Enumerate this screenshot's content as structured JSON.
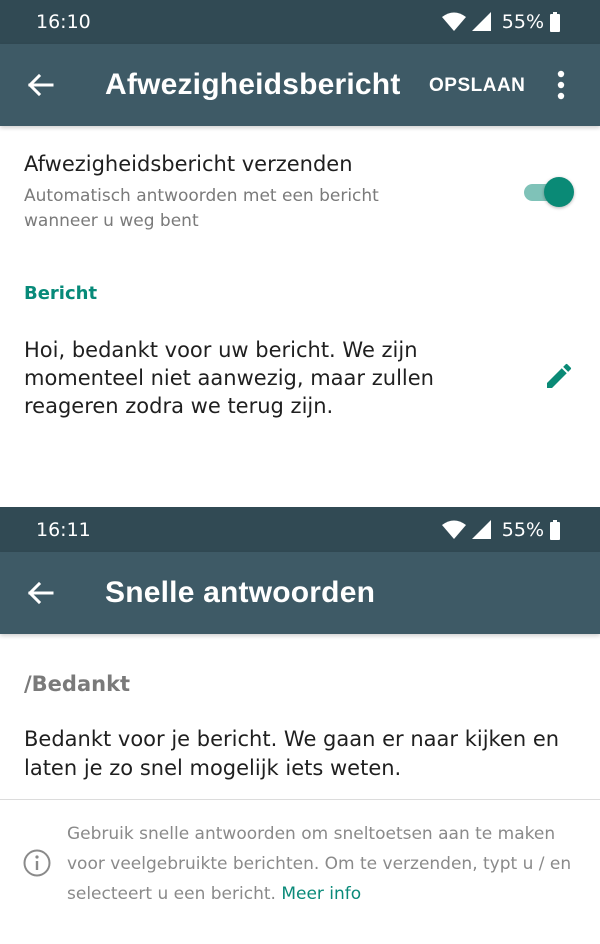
{
  "screen1": {
    "status": {
      "time": "16:10",
      "battery": "55%"
    },
    "toolbar": {
      "title": "Afwezigheidsbericht",
      "save_label": "OPSLAAN"
    },
    "setting": {
      "title": "Afwezigheidsbericht verzenden",
      "subtitle": "Automatisch antwoorden met een bericht wanneer u weg bent",
      "enabled": true
    },
    "section_label": "Bericht",
    "message": "Hoi, bedankt voor uw bericht. We zijn momenteel niet aanwezig, maar zullen reageren zodra we terug zijn."
  },
  "screen2": {
    "status": {
      "time": "16:11",
      "battery": "55%"
    },
    "toolbar": {
      "title": "Snelle antwoorden"
    },
    "quick_reply": {
      "shortcut": "/Bedankt",
      "message": "Bedankt voor je bericht. We gaan er naar kijken en laten je zo snel mogelijk iets weten."
    },
    "info": {
      "text": "Gebruik snelle antwoorden om sneltoetsen aan te maken voor veelgebruikte berichten. Om te verzenden, typt u / en selecteert u een bericht.",
      "link": "Meer info"
    }
  },
  "colors": {
    "statusbar": "#314a54",
    "toolbar": "#3e5a66",
    "accent": "#078a79"
  },
  "icons": [
    "back-arrow-icon",
    "wifi-icon",
    "cell-signal-icon",
    "battery-icon",
    "more-vert-icon",
    "pencil-icon",
    "info-icon"
  ]
}
